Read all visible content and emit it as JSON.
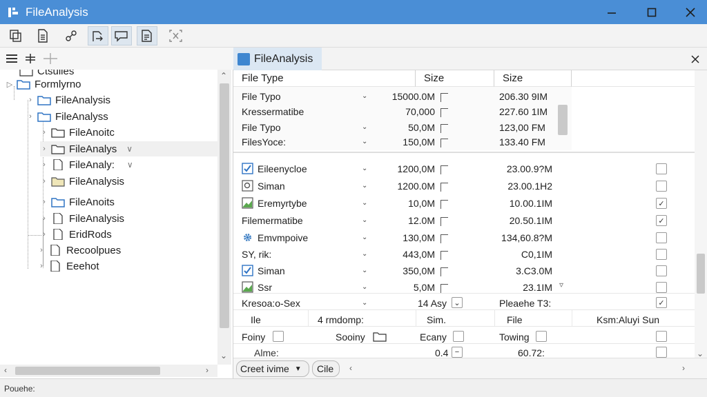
{
  "window": {
    "title": "FileAnalysis",
    "accent": "#4a8ed6"
  },
  "toolbar": {
    "icons": [
      "copy-icon",
      "document-icon",
      "link-icon",
      "export-icon",
      "comment-icon",
      "report-icon",
      "selection-icon"
    ]
  },
  "tree": {
    "items": [
      {
        "label": "Ctsulles"
      },
      {
        "label": "Formlyrno"
      },
      {
        "label": "FileAnalysis"
      },
      {
        "label": "FileAnalyss"
      },
      {
        "label": "FileAnoitc"
      },
      {
        "label": "FileAnalys",
        "suffix": "∨"
      },
      {
        "label": "FileAnaly:",
        "suffix": "∨"
      },
      {
        "label": "FileAnalysis"
      },
      {
        "label": "FileAnoits"
      },
      {
        "label": "FileAnalysis"
      },
      {
        "label": "EridRods"
      },
      {
        "label": "Recoolpues"
      },
      {
        "label": "Eeehot"
      }
    ]
  },
  "right": {
    "tab_label": "FileAnalysis",
    "headers": [
      "File Type",
      "Size",
      "Size"
    ],
    "top_rows": [
      {
        "name": "File Typo",
        "size": "15000.0M",
        "size2": "206.30 9IM",
        "dd": true
      },
      {
        "name": "Kressermatibe",
        "size": "70,000",
        "size2": "227.60 1IM",
        "dd": false
      },
      {
        "name": "File Typo",
        "size": "50,0M",
        "size2": "123,00 FM",
        "dd": true
      },
      {
        "name": "FilesYoce:",
        "size": "150,0M",
        "size2": "133.40 FM",
        "dd": true
      }
    ],
    "rows": [
      {
        "icon": "check",
        "name": "Eileenycloe",
        "size": "1200,0M",
        "size2": "23.00.9?M",
        "checked": false
      },
      {
        "icon": "search",
        "name": "Siman",
        "size": "1200.0M",
        "size2": "23.00.1H2",
        "checked": false
      },
      {
        "icon": "image",
        "name": "Eremyrtybe",
        "size": "10,0M",
        "size2": "10.00.1IM",
        "checked": true
      },
      {
        "icon": "none",
        "name": "Filemermatibe",
        "size": "12.0M",
        "size2": "20.50.1IM",
        "checked": true
      },
      {
        "icon": "gear",
        "name": "Emvmpoive",
        "size": "130,0M",
        "size2": "134,60.8?M",
        "checked": false
      },
      {
        "icon": "none",
        "name": "SY, rik:",
        "size": "443,0M",
        "size2": "C0,1IM",
        "checked": false
      },
      {
        "icon": "check",
        "name": "Siman",
        "size": "350,0M",
        "size2": "3.C3.0M",
        "checked": false
      },
      {
        "icon": "image",
        "name": "Ssr",
        "size": "5,0M",
        "size2": "23.1IM",
        "checked": false
      }
    ],
    "footer1": {
      "name": "Kresoa:o-Sex",
      "mid": "14 Asy",
      "right": "Pleaehe T3:",
      "checked": true
    },
    "footer2": {
      "a": "Ile",
      "b": "4 rmdomp:",
      "c": "Sim.",
      "d": "File",
      "e": "Ksm:Aluyi Sun"
    },
    "footer3": {
      "a": "Foiny",
      "b": "Sooiny",
      "c": "Ecany",
      "d": "Towing"
    },
    "footer4": {
      "a": "Alme:",
      "b": "0.4",
      "c": "60.72:"
    },
    "bottom_tabs": [
      {
        "label": "Creet ivime"
      },
      {
        "label": "Cile"
      }
    ]
  },
  "status": {
    "text": "Pouehe:"
  }
}
